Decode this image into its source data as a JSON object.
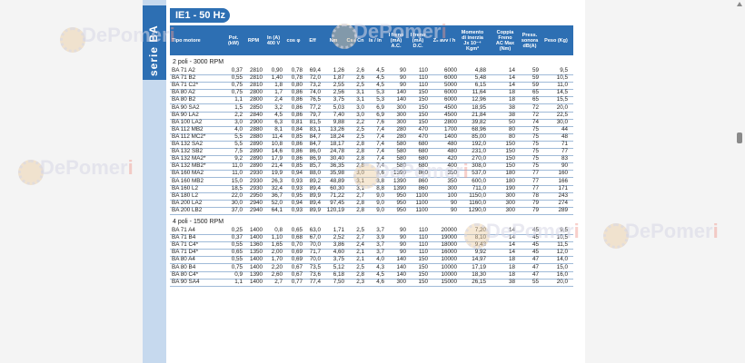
{
  "series_label": "serie BA",
  "frequency_badge": "IE1 - 50 Hz",
  "columns": [
    {
      "key": "tipo",
      "label": "Tipo motore"
    },
    {
      "key": "pot",
      "label": "Pot. (kW)"
    },
    {
      "key": "rpm",
      "label": "RPM"
    },
    {
      "key": "in",
      "label": "In (A) 400 V"
    },
    {
      "key": "cos",
      "label": "cos φ"
    },
    {
      "key": "eff",
      "label": "Eff"
    },
    {
      "key": "nm",
      "label": "Nm"
    },
    {
      "key": "cscn",
      "label": "Cs / Cn"
    },
    {
      "key": "isin",
      "label": "Is / In"
    },
    {
      "key": "ifac",
      "label": "I freno (mA) A.C."
    },
    {
      "key": "ifdc",
      "label": "I freno (mA) D.C."
    },
    {
      "key": "z",
      "label": "Z₀ avv / h"
    },
    {
      "key": "jx",
      "label": "Momento di inerzia Jx 10⁻⁴ Kgm²"
    },
    {
      "key": "coppia",
      "label": "Coppia Freno AC Max (Nm)"
    },
    {
      "key": "press",
      "label": "Press. sonora dB(A)"
    },
    {
      "key": "peso",
      "label": "Peso (Kg)"
    }
  ],
  "sections": [
    {
      "title": "2 poli - 3000 RPM",
      "rows": [
        [
          "BA 71 A2",
          "0,37",
          "2810",
          "0,90",
          "0,78",
          "69,4",
          "1,26",
          "2,6",
          "4,5",
          "90",
          "110",
          "6000",
          "4,88",
          "14",
          "59",
          "9,5"
        ],
        [
          "BA 71 B2",
          "0,55",
          "2810",
          "1,40",
          "0,78",
          "72,0",
          "1,87",
          "2,6",
          "4,5",
          "90",
          "110",
          "6000",
          "5,48",
          "14",
          "59",
          "10,5"
        ],
        [
          "BA 71 C2*",
          "0,75",
          "2810",
          "1,8",
          "0,80",
          "73,2",
          "2,55",
          "2,5",
          "4,5",
          "90",
          "110",
          "5000",
          "6,15",
          "14",
          "59",
          "11,0"
        ],
        [
          "BA 80 A2",
          "0,75",
          "2800",
          "1,7",
          "0,86",
          "74,0",
          "2,56",
          "3,1",
          "5,3",
          "140",
          "150",
          "6000",
          "11,64",
          "18",
          "65",
          "14,5"
        ],
        [
          "BA 80 B2",
          "1,1",
          "2800",
          "2,4",
          "0,86",
          "76,5",
          "3,75",
          "3,1",
          "5,3",
          "140",
          "150",
          "6000",
          "12,96",
          "18",
          "65",
          "15,5"
        ],
        [
          "BA 90 SA2",
          "1,5",
          "2850",
          "3,2",
          "0,86",
          "77,2",
          "5,03",
          "3,0",
          "6,9",
          "300",
          "150",
          "4500",
          "18,95",
          "38",
          "72",
          "20,0"
        ],
        [
          "BA 90 LA2",
          "2,2",
          "2840",
          "4,5",
          "0,86",
          "79,7",
          "7,40",
          "3,0",
          "6,9",
          "300",
          "150",
          "4500",
          "21,84",
          "38",
          "72",
          "22,5"
        ],
        [
          "BA 100 LA2",
          "3,0",
          "2900",
          "6,3",
          "0,81",
          "81,5",
          "9,88",
          "2,2",
          "7,6",
          "300",
          "150",
          "2800",
          "39,82",
          "50",
          "74",
          "30,0"
        ],
        [
          "BA 112 MB2",
          "4,0",
          "2880",
          "8,1",
          "0,84",
          "83,1",
          "13,26",
          "2,5",
          "7,4",
          "280",
          "470",
          "1700",
          "68,96",
          "80",
          "75",
          "44"
        ],
        [
          "BA 112 MC2*",
          "5,5",
          "2880",
          "11,4",
          "0,85",
          "84,7",
          "18,24",
          "2,5",
          "7,4",
          "280",
          "470",
          "1400",
          "85,00",
          "80",
          "75",
          "48"
        ],
        [
          "BA 132 SA2",
          "5,5",
          "2890",
          "10,8",
          "0,86",
          "84,7",
          "18,17",
          "2,8",
          "7,4",
          "580",
          "680",
          "480",
          "192,0",
          "150",
          "75",
          "71"
        ],
        [
          "BA 132 SB2",
          "7,5",
          "2890",
          "14,6",
          "0,86",
          "86,0",
          "24,78",
          "2,8",
          "7,4",
          "580",
          "680",
          "480",
          "231,0",
          "150",
          "75",
          "77"
        ],
        [
          "BA 132 MA2*",
          "9,2",
          "2890",
          "17,9",
          "0,86",
          "86,9",
          "30,40",
          "2,8",
          "7,4",
          "580",
          "680",
          "420",
          "270,0",
          "150",
          "75",
          "83"
        ],
        [
          "BA 132 MB2*",
          "11,0",
          "2890",
          "21,4",
          "0,85",
          "85,7",
          "36,35",
          "2,8",
          "7,4",
          "580",
          "680",
          "400",
          "308,0",
          "150",
          "75",
          "90"
        ],
        [
          "BA 160 MA2",
          "11,0",
          "2930",
          "19,9",
          "0,94",
          "88,0",
          "35,98",
          "3,0",
          "8,6",
          "1390",
          "860",
          "350",
          "537,0",
          "180",
          "77",
          "160"
        ],
        [
          "BA 160 MB2",
          "15,0",
          "2930",
          "26,3",
          "0,93",
          "89,2",
          "48,89",
          "3,1",
          "8,8",
          "1390",
          "860",
          "350",
          "600,0",
          "180",
          "77",
          "166"
        ],
        [
          "BA 160 L2",
          "18,5",
          "2930",
          "32,4",
          "0,93",
          "89,4",
          "60,30",
          "3,1",
          "8,8",
          "1390",
          "860",
          "300",
          "711,0",
          "190",
          "77",
          "171"
        ],
        [
          "BA 180 L2",
          "22,0",
          "2950",
          "36,7",
          "0,95",
          "89,9",
          "71,22",
          "2,7",
          "9,0",
          "950",
          "1100",
          "100",
          "1150,0",
          "300",
          "78",
          "243"
        ],
        [
          "BA 200 LA2",
          "30,0",
          "2940",
          "52,0",
          "0,94",
          "89,4",
          "97,45",
          "2,8",
          "9,0",
          "950",
          "1100",
          "90",
          "1160,0",
          "300",
          "79",
          "274"
        ],
        [
          "BA 200 LB2",
          "37,0",
          "2940",
          "64,1",
          "0,93",
          "89,9",
          "120,19",
          "2,8",
          "9,0",
          "950",
          "1100",
          "90",
          "1290,0",
          "300",
          "79",
          "289"
        ]
      ]
    },
    {
      "title": "4 poli - 1500 RPM",
      "rows": [
        [
          "BA 71 A4",
          "0,25",
          "1400",
          "0,8",
          "0,65",
          "63,0",
          "1,71",
          "2,5",
          "3,7",
          "90",
          "110",
          "20000",
          "7,20",
          "14",
          "45",
          "9,5"
        ],
        [
          "BA 71 B4",
          "0,37",
          "1400",
          "1,10",
          "0,68",
          "67,0",
          "2,52",
          "2,7",
          "3,9",
          "90",
          "110",
          "19000",
          "8,10",
          "14",
          "45",
          "10,5"
        ],
        [
          "BA 71 C4*",
          "0,55",
          "1360",
          "1,65",
          "0,70",
          "70,0",
          "3,86",
          "2,4",
          "3,7",
          "90",
          "110",
          "18000",
          "9,43",
          "14",
          "45",
          "11,5"
        ],
        [
          "BA 71 D4*",
          "0,65",
          "1350",
          "2,00",
          "0,69",
          "71,7",
          "4,60",
          "2,1",
          "3,7",
          "90",
          "110",
          "16000",
          "9,92",
          "14",
          "45",
          "12,0"
        ],
        [
          "BA 80 A4",
          "0,55",
          "1400",
          "1,70",
          "0,69",
          "70,0",
          "3,75",
          "2,1",
          "4,0",
          "140",
          "150",
          "10000",
          "14,97",
          "18",
          "47",
          "14,0"
        ],
        [
          "BA 80 B4",
          "0,75",
          "1400",
          "2,20",
          "0,67",
          "73,5",
          "5,12",
          "2,5",
          "4,3",
          "140",
          "150",
          "10000",
          "17,19",
          "18",
          "47",
          "15,0"
        ],
        [
          "BA 80 C4*",
          "0,9",
          "1390",
          "2,60",
          "0,67",
          "73,6",
          "6,18",
          "2,8",
          "4,5",
          "140",
          "150",
          "10000",
          "18,30",
          "18",
          "47",
          "16,0"
        ],
        [
          "BA 90 SA4",
          "1,1",
          "1400",
          "2,7",
          "0,77",
          "77,4",
          "7,50",
          "2,3",
          "4,6",
          "300",
          "150",
          "15000",
          "26,15",
          "38",
          "55",
          "20,0"
        ]
      ]
    }
  ]
}
